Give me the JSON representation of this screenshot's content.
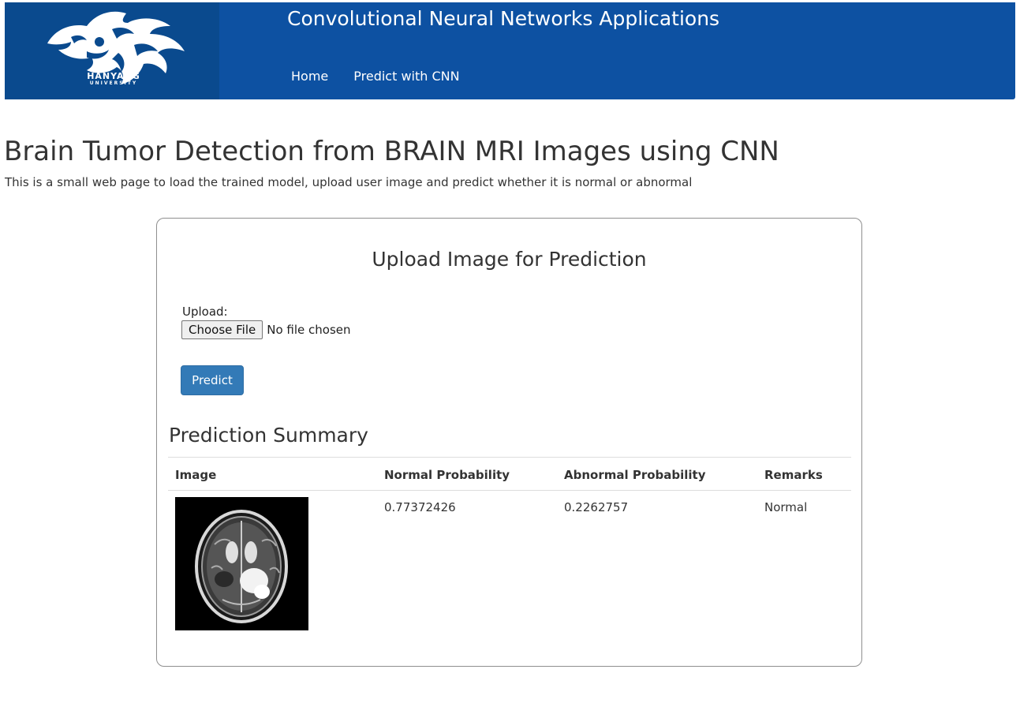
{
  "header": {
    "logo_text": "HANYANG",
    "logo_subtext": "UNIVERSITY",
    "site_title": "Convolutional Neural Networks Applications",
    "nav": [
      {
        "label": "Home"
      },
      {
        "label": "Predict with CNN"
      }
    ]
  },
  "page": {
    "title": "Brain Tumor Detection from BRAIN MRI Images using CNN",
    "subtitle": "This is a small web page to load the trained model, upload user image and predict whether it is normal or abnormal"
  },
  "upload_card": {
    "title": "Upload Image for Prediction",
    "upload_label": "Upload:",
    "choose_file_label": "Choose File",
    "file_status": "No file chosen",
    "predict_label": "Predict"
  },
  "summary": {
    "title": "Prediction Summary",
    "columns": [
      "Image",
      "Normal Probability",
      "Abnormal Probability",
      "Remarks"
    ],
    "rows": [
      {
        "image": "brain-mri-thumbnail",
        "normal_probability": "0.77372426",
        "abnormal_probability": "0.2262757",
        "remarks": "Normal"
      }
    ]
  },
  "colors": {
    "header_blue": "#0d51a2",
    "logo_panel_blue": "#0a4a8e",
    "primary_button": "#337ab7",
    "text": "#333333"
  }
}
